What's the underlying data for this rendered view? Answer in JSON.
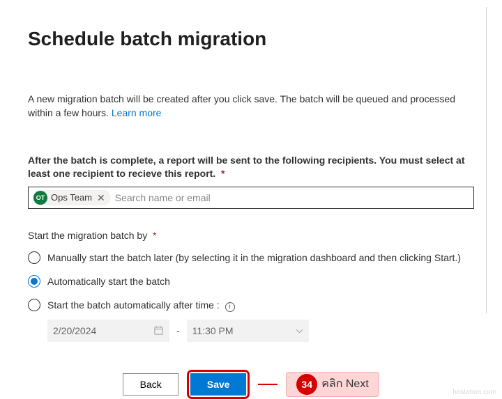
{
  "title": "Schedule batch migration",
  "intro_text": "A new migration batch will be created after you click save. The batch will be queued and processed within a few hours. ",
  "learn_more": "Learn more",
  "recipients": {
    "label": "After the batch is complete, a report will be sent to the following recipients. You must select at least one recipient to recieve this report.",
    "chip_initials": "OT",
    "chip_name": "Ops Team",
    "placeholder": "Search name or email"
  },
  "start_section": {
    "label": "Start the migration batch by",
    "opt_manual": "Manually start the batch later (by selecting it in the migration dashboard and then clicking Start.)",
    "opt_auto": "Automatically start the batch",
    "opt_time": "Start the batch automatically after time :",
    "date_value": "2/20/2024",
    "time_value": "11:30 PM"
  },
  "buttons": {
    "back": "Back",
    "save": "Save"
  },
  "callout": {
    "number": "34",
    "text": "คลิก Next"
  },
  "watermark": "hostatom.com"
}
